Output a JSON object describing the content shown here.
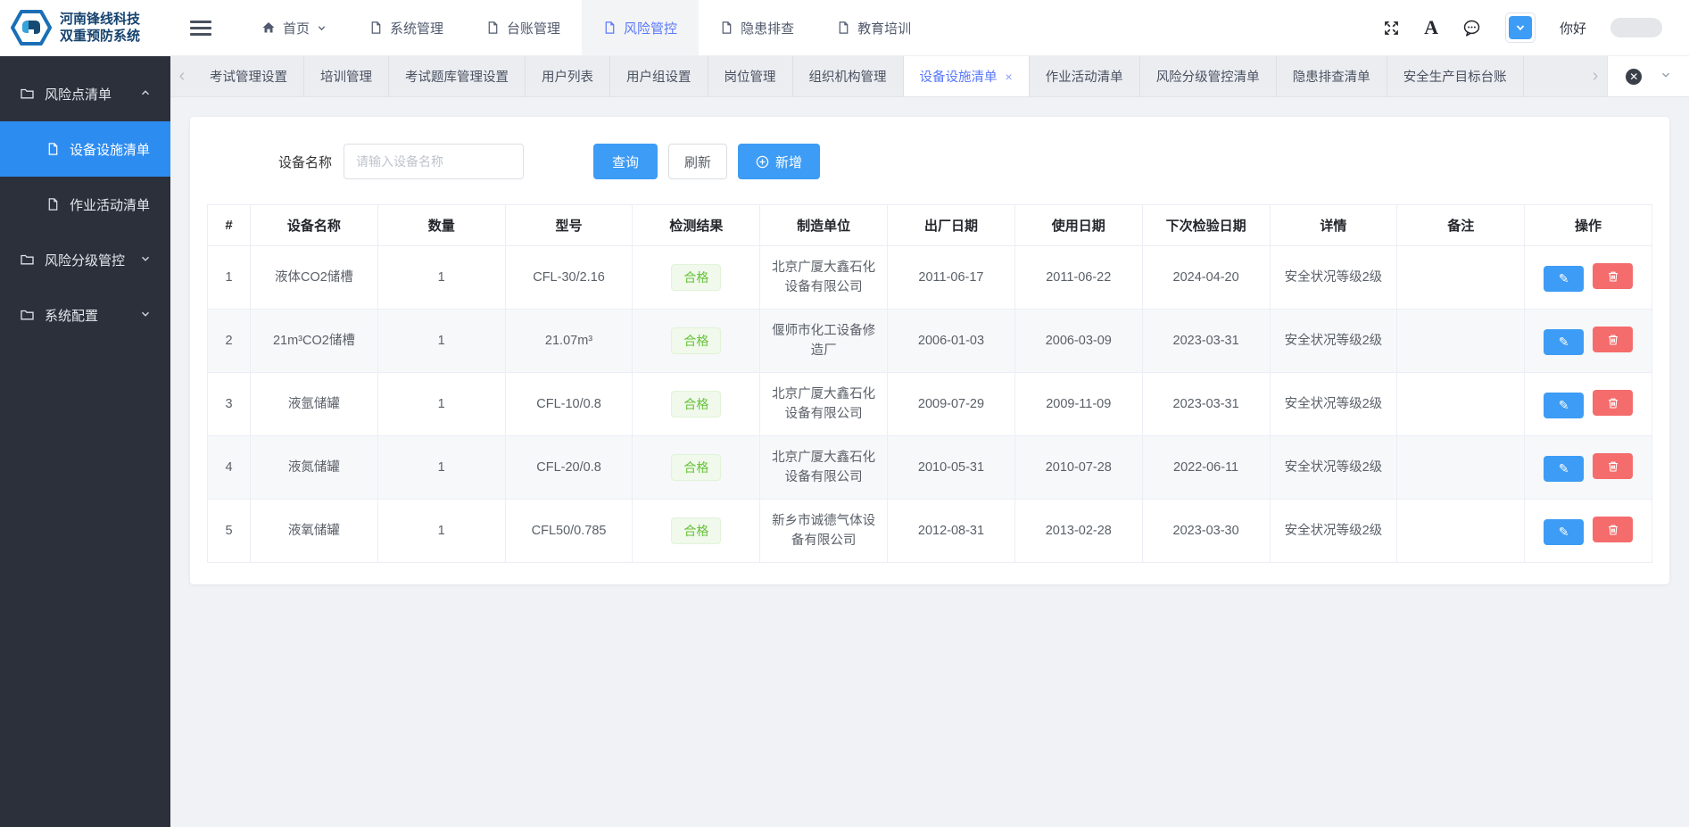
{
  "app": {
    "logo_line1": "河南锋线科技",
    "logo_line2": "双重预防系统"
  },
  "topnav": {
    "items": [
      {
        "label": "首页"
      },
      {
        "label": "系统管理"
      },
      {
        "label": "台账管理"
      },
      {
        "label": "风险管控"
      },
      {
        "label": "隐患排查"
      },
      {
        "label": "教育培训"
      }
    ],
    "greeting": "你好"
  },
  "tabbar": {
    "tabs": [
      {
        "label": "考试管理设置"
      },
      {
        "label": "培训管理"
      },
      {
        "label": "考试题库管理设置"
      },
      {
        "label": "用户列表"
      },
      {
        "label": "用户组设置"
      },
      {
        "label": "岗位管理"
      },
      {
        "label": "组织机构管理"
      },
      {
        "label": "设备设施清单",
        "close": "×"
      },
      {
        "label": "作业活动清单"
      },
      {
        "label": "风险分级管控清单"
      },
      {
        "label": "隐患排查清单"
      },
      {
        "label": "安全生产目标台账"
      }
    ]
  },
  "sidebar": {
    "groups": [
      {
        "label": "风险点清单"
      },
      {
        "label": "风险分级管控"
      },
      {
        "label": "系统配置"
      }
    ],
    "children": [
      {
        "label": "设备设施清单"
      },
      {
        "label": "作业活动清单"
      }
    ]
  },
  "filter": {
    "label": "设备名称",
    "placeholder": "请输入设备名称",
    "search": "查询",
    "refresh": "刷新",
    "add": "新增"
  },
  "table": {
    "columns": [
      "#",
      "设备名称",
      "数量",
      "型号",
      "检测结果",
      "制造单位",
      "出厂日期",
      "使用日期",
      "下次检验日期",
      "详情",
      "备注",
      "操作"
    ],
    "rows": [
      {
        "index": "1",
        "name": "液体CO2储槽",
        "qty": "1",
        "model": "CFL-30/2.16",
        "result": "合格",
        "manufacturer": "北京广厦大鑫石化设备有限公司",
        "factory_date": "2011-06-17",
        "use_date": "2011-06-22",
        "next_check": "2024-04-20",
        "detail": "安全状况等级2级",
        "remark": ""
      },
      {
        "index": "2",
        "name": "21m³CO2储槽",
        "qty": "1",
        "model": "21.07m³",
        "result": "合格",
        "manufacturer": "偃师市化工设备修造厂",
        "factory_date": "2006-01-03",
        "use_date": "2006-03-09",
        "next_check": "2023-03-31",
        "detail": "安全状况等级2级",
        "remark": ""
      },
      {
        "index": "3",
        "name": "液氩储罐",
        "qty": "1",
        "model": "CFL-10/0.8",
        "result": "合格",
        "manufacturer": "北京广厦大鑫石化设备有限公司",
        "factory_date": "2009-07-29",
        "use_date": "2009-11-09",
        "next_check": "2023-03-31",
        "detail": "安全状况等级2级",
        "remark": ""
      },
      {
        "index": "4",
        "name": "液氮储罐",
        "qty": "1",
        "model": "CFL-20/0.8",
        "result": "合格",
        "manufacturer": "北京广厦大鑫石化设备有限公司",
        "factory_date": "2010-05-31",
        "use_date": "2010-07-28",
        "next_check": "2022-06-11",
        "detail": "安全状况等级2级",
        "remark": ""
      },
      {
        "index": "5",
        "name": "液氧储罐",
        "qty": "1",
        "model": "CFL50/0.785",
        "result": "合格",
        "manufacturer": "新乡市诚德气体设备有限公司",
        "factory_date": "2012-08-31",
        "use_date": "2013-02-28",
        "next_check": "2023-03-30",
        "detail": "安全状况等级2级",
        "remark": ""
      }
    ]
  },
  "colors": {
    "accent": "#5a78fa",
    "primary_button": "#3d9cf5",
    "danger": "#f56c6c",
    "success": "#67c23a",
    "sidebar_active": "#2d8cf0"
  }
}
